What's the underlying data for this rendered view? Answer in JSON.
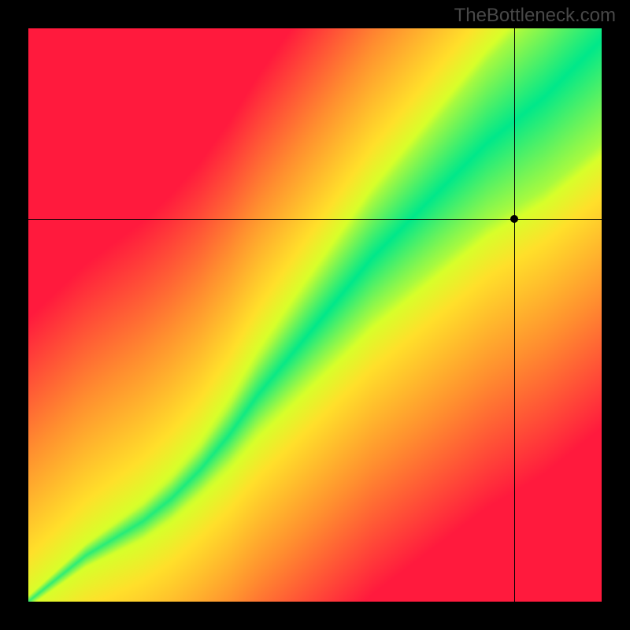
{
  "watermark": "TheBottleneck.com",
  "crosshair": {
    "x_pct": 84.7,
    "y_pct": 33.2
  },
  "colors": {
    "low": "#ff1a3d",
    "mid_low": "#ff8f2f",
    "mid": "#ffe02a",
    "mid_high": "#d8ff2a",
    "high": "#00e88a"
  },
  "chart_data": {
    "type": "heatmap",
    "title": "",
    "xlabel": "",
    "ylabel": "",
    "x_range": [
      0,
      100
    ],
    "y_range": [
      0,
      100
    ],
    "grid": false,
    "legend": "none",
    "annotations": [
      {
        "type": "vline",
        "x": 84.7
      },
      {
        "type": "hline",
        "y": 66.8
      },
      {
        "type": "point",
        "x": 84.7,
        "y": 66.8
      }
    ],
    "curve_centerline": [
      {
        "x": 0,
        "y": 0
      },
      {
        "x": 5,
        "y": 4
      },
      {
        "x": 10,
        "y": 8
      },
      {
        "x": 15,
        "y": 11
      },
      {
        "x": 20,
        "y": 14
      },
      {
        "x": 25,
        "y": 18
      },
      {
        "x": 30,
        "y": 23
      },
      {
        "x": 35,
        "y": 29
      },
      {
        "x": 40,
        "y": 36
      },
      {
        "x": 45,
        "y": 42
      },
      {
        "x": 50,
        "y": 48
      },
      {
        "x": 55,
        "y": 54
      },
      {
        "x": 60,
        "y": 60
      },
      {
        "x": 65,
        "y": 65
      },
      {
        "x": 70,
        "y": 70
      },
      {
        "x": 75,
        "y": 75
      },
      {
        "x": 80,
        "y": 80
      },
      {
        "x": 85,
        "y": 84
      },
      {
        "x": 90,
        "y": 88
      },
      {
        "x": 95,
        "y": 93
      },
      {
        "x": 100,
        "y": 98
      }
    ],
    "band_width_pct": [
      {
        "x": 0,
        "w": 1
      },
      {
        "x": 10,
        "w": 2
      },
      {
        "x": 20,
        "w": 3
      },
      {
        "x": 30,
        "w": 4
      },
      {
        "x": 40,
        "w": 6
      },
      {
        "x": 50,
        "w": 8
      },
      {
        "x": 60,
        "w": 10
      },
      {
        "x": 70,
        "w": 12
      },
      {
        "x": 80,
        "w": 14
      },
      {
        "x": 90,
        "w": 16
      },
      {
        "x": 100,
        "w": 18
      }
    ],
    "description": "Distance-based heatmap: value = closeness to centerline curve; green at curve, yellow near, red far. Curve widens toward top-right. Crosshair marks a single point at (84.7, 66.8). Chart origin bottom-left."
  }
}
